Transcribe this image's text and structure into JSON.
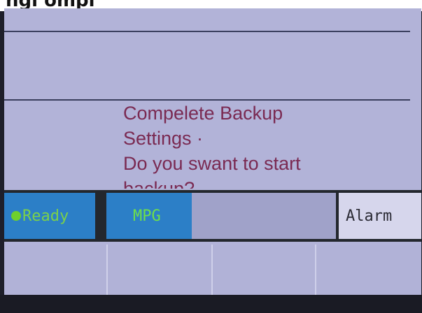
{
  "header_caption": "ngi         ompl              ",
  "dialog": {
    "line1": "Compelete Backup",
    "line2": "Settings ·",
    "line3": "Do you swant to start",
    "line4": "backup?"
  },
  "status_bar": {
    "ready": "Ready",
    "mode": "MPG",
    "alarm": "Alarm"
  },
  "colors": {
    "screen_bg": "#b2b3d8",
    "message_text": "#7a2a52",
    "status_blue": "#2c7fc7",
    "status_green": "#6fd02c"
  }
}
